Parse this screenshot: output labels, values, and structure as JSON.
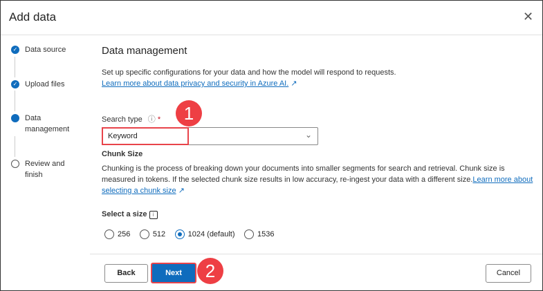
{
  "dialog": {
    "title": "Add data",
    "close": "✕"
  },
  "steps": [
    {
      "label": "Data source",
      "state": "done"
    },
    {
      "label": "Upload files",
      "state": "done"
    },
    {
      "label": "Data management",
      "state": "current"
    },
    {
      "label": "Review and finish",
      "state": "pending"
    }
  ],
  "main": {
    "heading": "Data management",
    "description": "Set up specific configurations for your data and how the model will respond to requests.",
    "privacy_link": "Learn more about data privacy and security in Azure AI.",
    "search_type_label": "Search type",
    "required": "*",
    "search_type_value": "Keyword",
    "chunk_heading": "Chunk Size",
    "chunk_text": "Chunking is the process of breaking down your documents into smaller segments for search and retrieval. Chunk size is measured in tokens. If the selected chunk size results in low accuracy, re-ingest your data with a different size.",
    "chunk_link": "Learn more about selecting a chunk size",
    "select_size_label": "Select a size",
    "sizes": [
      {
        "label": "256",
        "selected": false
      },
      {
        "label": "512",
        "selected": false
      },
      {
        "label": "1024 (default)",
        "selected": true
      },
      {
        "label": "1536",
        "selected": false
      }
    ]
  },
  "footer": {
    "back": "Back",
    "next": "Next",
    "cancel": "Cancel"
  },
  "annotations": [
    "1",
    "2"
  ]
}
